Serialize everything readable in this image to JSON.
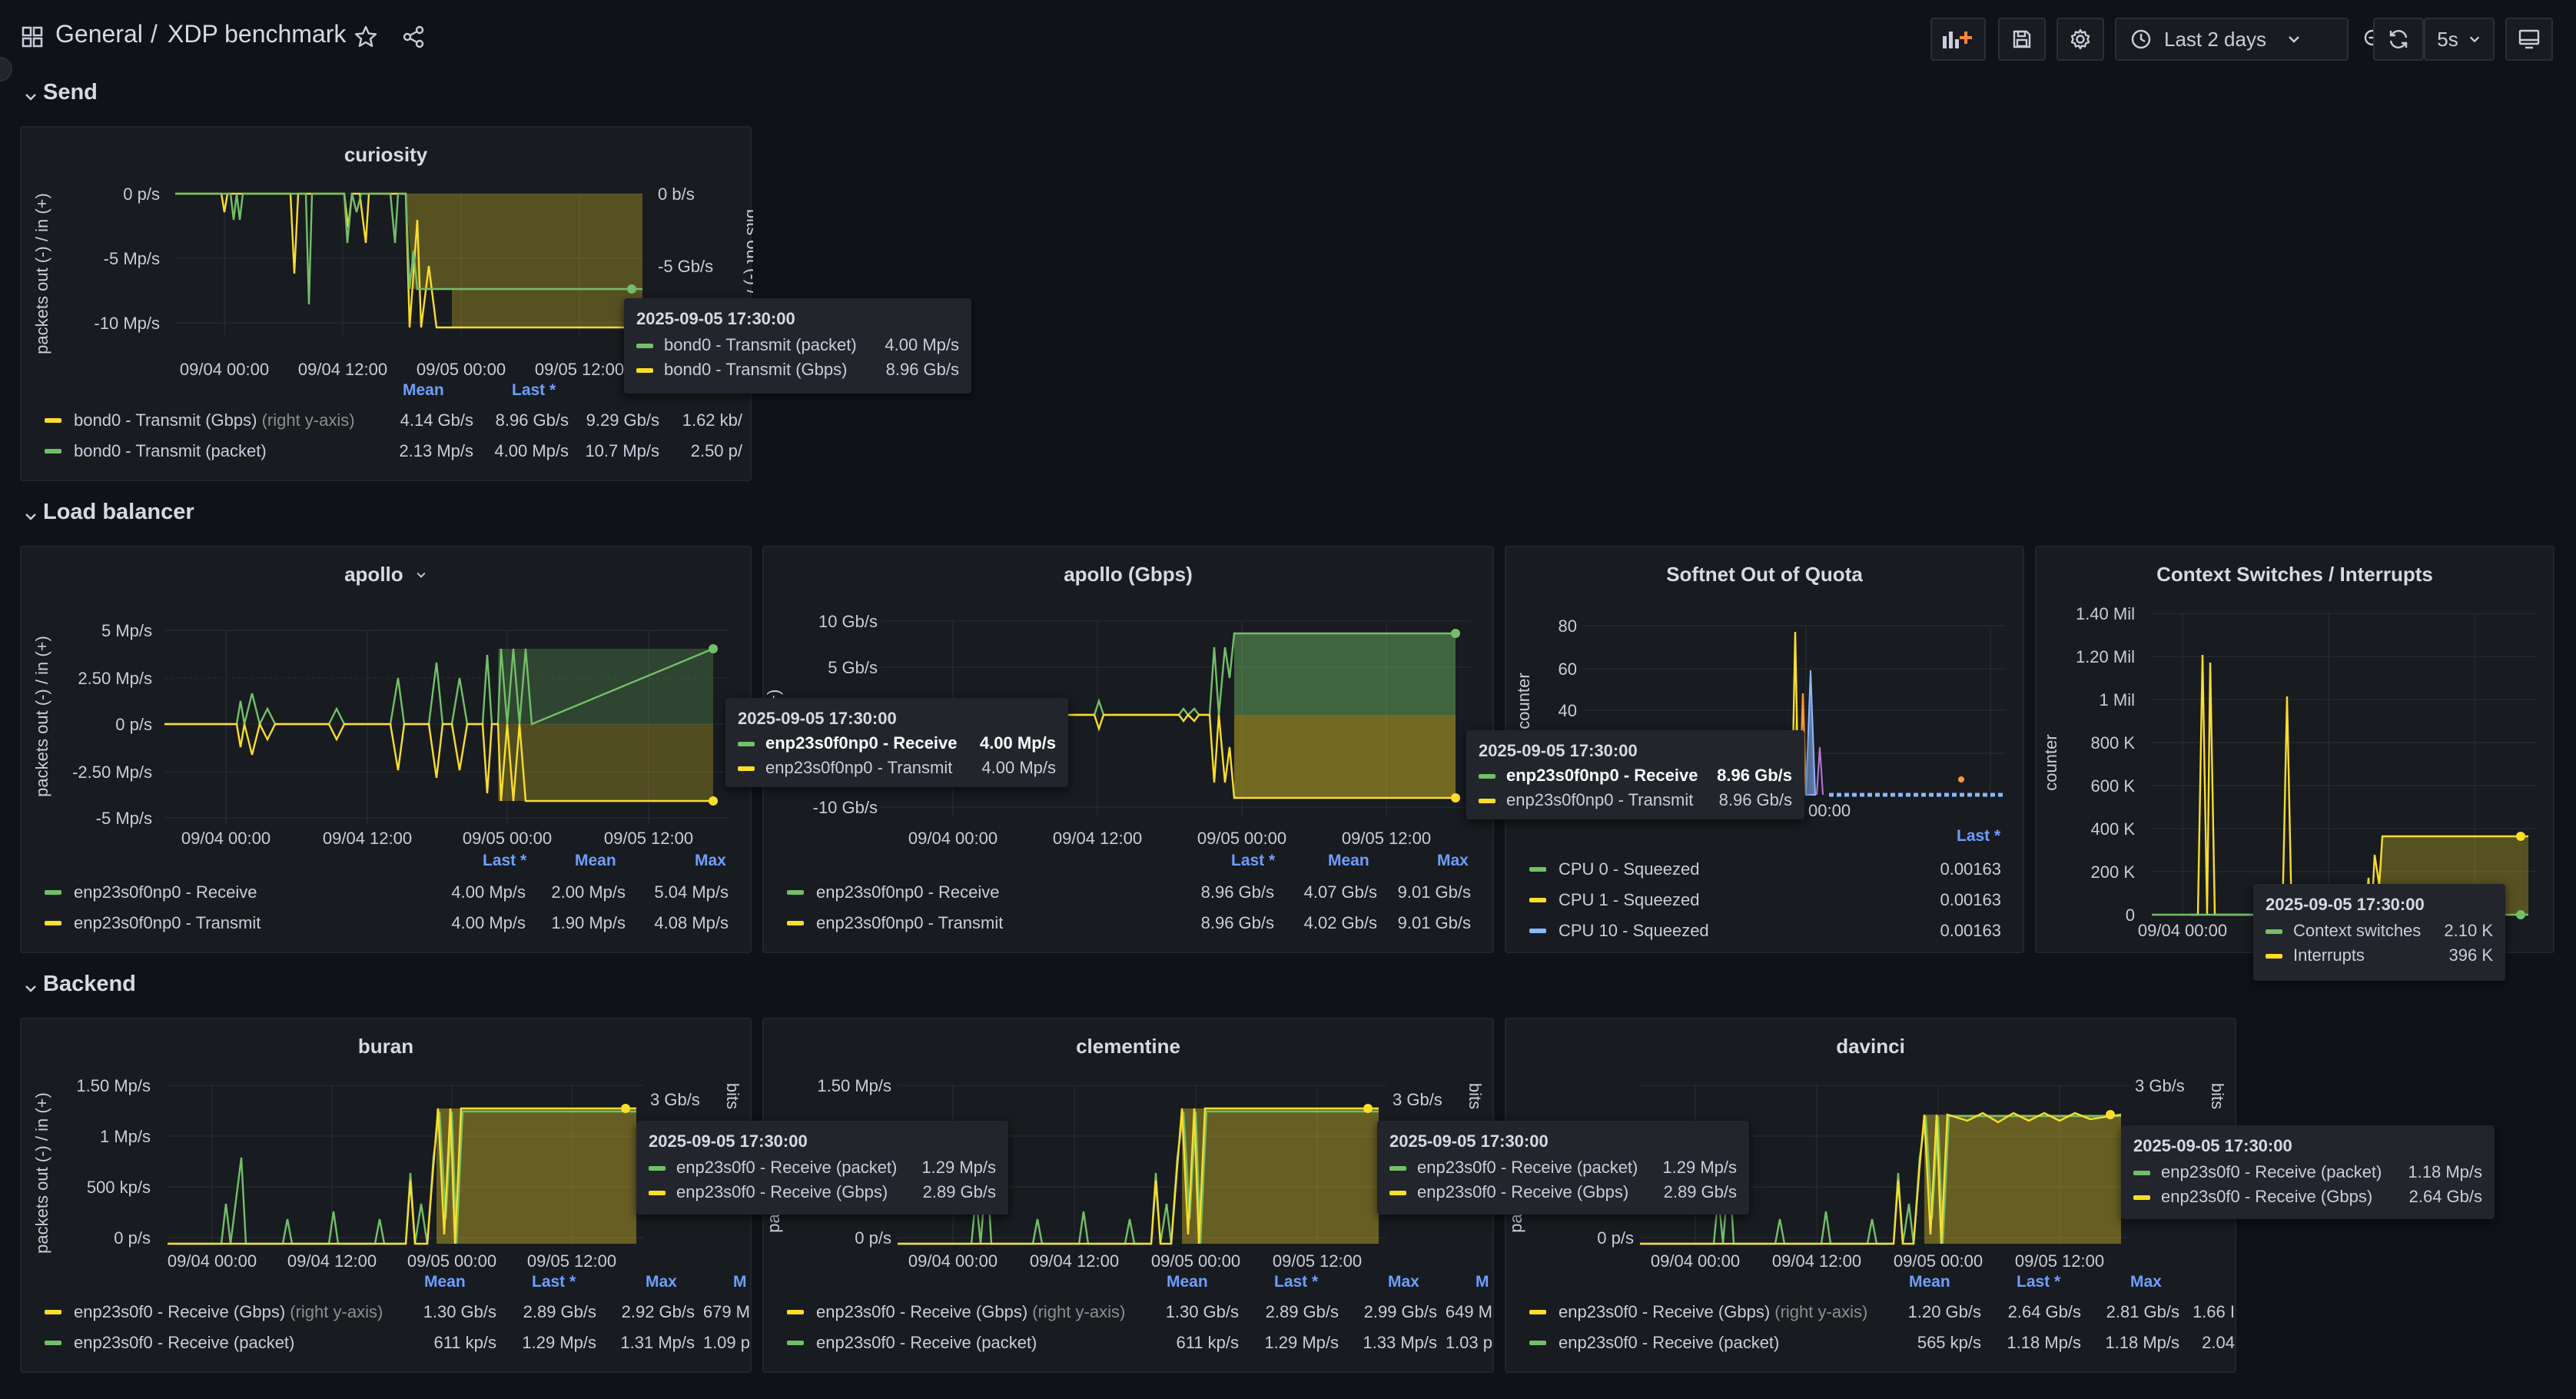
{
  "nav": {
    "breadcrumb_root": "General",
    "breadcrumb_sep": "/",
    "dashboard_title": "XDP benchmark",
    "time_range": "Last 2 days",
    "refresh_interval": "5s"
  },
  "colors": {
    "green": "#73bf69",
    "yellow": "#fade2a",
    "blue": "#8ab8ff",
    "legend_header": "#6e9fff",
    "background": "#111217",
    "panel": "#181b1f"
  },
  "rows": {
    "send": "Send",
    "load_balancer": "Load balancer",
    "backend": "Backend"
  },
  "curiosity": {
    "title": "curiosity",
    "y_left_label": "packets out (-) / in (+)",
    "y_right_label": "bits out (-) / in (+)",
    "y_left_ticks": [
      "0 p/s",
      "-5 Mp/s",
      "-10 Mp/s"
    ],
    "y_right_ticks": [
      "0 b/s",
      "-5 Gb/s"
    ],
    "x_ticks": [
      "09/04 00:00",
      "09/04 12:00",
      "09/05 00:00",
      "09/05 12:00"
    ],
    "legend_headers": [
      "Mean",
      "Last *"
    ],
    "legend": [
      {
        "name": "bond0 - Transmit (Gbps)",
        "suffix": "(right y-axis)",
        "color": "yellow",
        "values": [
          "4.14 Gb/s",
          "8.96 Gb/s",
          "9.29 Gb/s",
          "1.62 kb/"
        ]
      },
      {
        "name": "bond0 - Transmit (packet)",
        "suffix": "",
        "color": "green",
        "values": [
          "2.13 Mp/s",
          "4.00 Mp/s",
          "10.7 Mp/s",
          "2.50 p/"
        ]
      }
    ],
    "tooltip": {
      "time": "2025-09-05 17:30:00",
      "rows": [
        {
          "name": "bond0 - Transmit (packet)",
          "value": "4.00 Mp/s",
          "color": "green"
        },
        {
          "name": "bond0 - Transmit (Gbps)",
          "value": "8.96 Gb/s",
          "color": "yellow"
        }
      ]
    }
  },
  "apollo": {
    "title": "apollo",
    "y_label": "packets out (-) / in (+)",
    "y_ticks": [
      "5 Mp/s",
      "2.50 Mp/s",
      "0 p/s",
      "-2.50 Mp/s",
      "-5 Mp/s"
    ],
    "x_ticks": [
      "09/04 00:00",
      "09/04 12:00",
      "09/05 00:00",
      "09/05 12:00"
    ],
    "legend_headers": [
      "Last *",
      "Mean",
      "Max"
    ],
    "legend": [
      {
        "name": "enp23s0f0np0 - Receive",
        "color": "green",
        "values": [
          "4.00 Mp/s",
          "2.00 Mp/s",
          "5.04 Mp/s"
        ]
      },
      {
        "name": "enp23s0f0np0 - Transmit",
        "color": "yellow",
        "values": [
          "4.00 Mp/s",
          "1.90 Mp/s",
          "4.08 Mp/s"
        ]
      }
    ],
    "tooltip": {
      "time": "2025-09-05 17:30:00",
      "rows": [
        {
          "name": "enp23s0f0np0 - Receive",
          "value": "4.00 Mp/s",
          "color": "green"
        },
        {
          "name": "enp23s0f0np0 - Transmit",
          "value": "4.00 Mp/s",
          "color": "yellow"
        }
      ]
    }
  },
  "apollo_gbps": {
    "title": "apollo (Gbps)",
    "y_label": "in (+)",
    "y_ticks": [
      "10 Gb/s",
      "5 Gb/s",
      "-10 Gb/s"
    ],
    "x_ticks": [
      "09/04 00:00",
      "09/04 12:00",
      "09/05 00:00",
      "09/05 12:00"
    ],
    "legend_headers": [
      "Last *",
      "Mean",
      "Max"
    ],
    "legend": [
      {
        "name": "enp23s0f0np0 - Receive",
        "color": "green",
        "values": [
          "8.96 Gb/s",
          "4.07 Gb/s",
          "9.01 Gb/s"
        ]
      },
      {
        "name": "enp23s0f0np0 - Transmit",
        "color": "yellow",
        "values": [
          "8.96 Gb/s",
          "4.02 Gb/s",
          "9.01 Gb/s"
        ]
      }
    ],
    "tooltip": {
      "time": "2025-09-05 17:30:00",
      "rows": [
        {
          "name": "enp23s0f0np0 - Receive",
          "value": "8.96 Gb/s",
          "color": "green"
        },
        {
          "name": "enp23s0f0np0 - Transmit",
          "value": "8.96 Gb/s",
          "color": "yellow"
        }
      ]
    }
  },
  "softnet": {
    "title": "Softnet Out of Quota",
    "y_label": "counter",
    "y_ticks": [
      "80",
      "60",
      "40"
    ],
    "x_ticks": [
      "09/05 00:00"
    ],
    "legend_headers": [
      "Last *"
    ],
    "legend": [
      {
        "name": "CPU 0 - Squeezed",
        "color": "green",
        "values": [
          "0.00163"
        ]
      },
      {
        "name": "CPU 1 - Squeezed",
        "color": "yellow",
        "values": [
          "0.00163"
        ]
      },
      {
        "name": "CPU 10 - Squeezed",
        "color": "blue",
        "values": [
          "0.00163"
        ]
      }
    ]
  },
  "ctx": {
    "title": "Context Switches / Interrupts",
    "y_label": "counter",
    "y_ticks": [
      "1.40 Mil",
      "1.20 Mil",
      "1 Mil",
      "800 K",
      "600 K",
      "400 K",
      "200 K",
      "0"
    ],
    "x_ticks": [
      "09/04 00:00"
    ],
    "tooltip": {
      "time": "2025-09-05 17:30:00",
      "rows": [
        {
          "name": "Context switches",
          "value": "2.10 K",
          "color": "green"
        },
        {
          "name": "Interrupts",
          "value": "396 K",
          "color": "yellow"
        }
      ]
    }
  },
  "buran": {
    "title": "buran",
    "y_left_label": "packets out (-) / in (+)",
    "y_right_label": "bits",
    "y_left_ticks": [
      "1.50 Mp/s",
      "1 Mp/s",
      "500 kp/s",
      "0 p/s"
    ],
    "y_right_ticks": [
      "3 Gb/s"
    ],
    "x_ticks": [
      "09/04 00:00",
      "09/04 12:00",
      "09/05 00:00",
      "09/05 12:00"
    ],
    "legend_headers": [
      "Mean",
      "Last *",
      "Max",
      "M"
    ],
    "legend": [
      {
        "name": "enp23s0f0 - Receive (Gbps)",
        "suffix": "(right y-axis)",
        "color": "yellow",
        "values": [
          "1.30 Gb/s",
          "2.89 Gb/s",
          "2.92 Gb/s",
          "679 M"
        ]
      },
      {
        "name": "enp23s0f0 - Receive (packet)",
        "suffix": "",
        "color": "green",
        "values": [
          "611 kp/s",
          "1.29 Mp/s",
          "1.31 Mp/s",
          "1.09 p"
        ]
      }
    ],
    "tooltip": {
      "time": "2025-09-05 17:30:00",
      "rows": [
        {
          "name": "enp23s0f0 - Receive (packet)",
          "value": "1.29 Mp/s",
          "color": "green"
        },
        {
          "name": "enp23s0f0 - Receive (Gbps)",
          "value": "2.89 Gb/s",
          "color": "yellow"
        }
      ]
    }
  },
  "clementine": {
    "title": "clementine",
    "y_left_label": "pac",
    "y_right_label": "bits",
    "y_left_ticks": [
      "1.50 Mp/s",
      "0 p/s"
    ],
    "y_right_ticks": [
      "3 Gb/s"
    ],
    "x_ticks": [
      "09/04 00:00",
      "09/04 12:00",
      "09/05 00:00",
      "09/05 12:00"
    ],
    "legend_headers": [
      "Mean",
      "Last *",
      "Max",
      "M"
    ],
    "legend": [
      {
        "name": "enp23s0f0 - Receive (Gbps)",
        "suffix": "(right y-axis)",
        "color": "yellow",
        "values": [
          "1.30 Gb/s",
          "2.89 Gb/s",
          "2.99 Gb/s",
          "649 M"
        ]
      },
      {
        "name": "enp23s0f0 - Receive (packet)",
        "suffix": "",
        "color": "green",
        "values": [
          "611 kp/s",
          "1.29 Mp/s",
          "1.33 Mp/s",
          "1.03 p"
        ]
      }
    ],
    "tooltip": {
      "time": "2025-09-05 17:30:00",
      "rows": [
        {
          "name": "enp23s0f0 - Receive (packet)",
          "value": "1.29 Mp/s",
          "color": "green"
        },
        {
          "name": "enp23s0f0 - Receive (Gbps)",
          "value": "2.89 Gb/s",
          "color": "yellow"
        }
      ]
    }
  },
  "davinci": {
    "title": "davinci",
    "y_left_label": "pac",
    "y_right_label": "bits",
    "y_left_ticks": [
      "0 p/s"
    ],
    "y_right_ticks": [
      "3 Gb/s"
    ],
    "x_ticks": [
      "09/04 00:00",
      "09/04 12:00",
      "09/05 00:00",
      "09/05 12:00"
    ],
    "legend_headers": [
      "Mean",
      "Last *",
      "Max"
    ],
    "legend": [
      {
        "name": "enp23s0f0 - Receive (Gbps)",
        "suffix": "(right y-axis)",
        "color": "yellow",
        "values": [
          "1.20 Gb/s",
          "2.64 Gb/s",
          "2.81 Gb/s",
          "1.66 I"
        ]
      },
      {
        "name": "enp23s0f0 - Receive (packet)",
        "suffix": "",
        "color": "green",
        "values": [
          "565 kp/s",
          "1.18 Mp/s",
          "1.18 Mp/s",
          "2.04"
        ]
      }
    ],
    "tooltip": {
      "time": "2025-09-05 17:30:00",
      "rows": [
        {
          "name": "enp23s0f0 - Receive (packet)",
          "value": "1.18 Mp/s",
          "color": "green"
        },
        {
          "name": "enp23s0f0 - Receive (Gbps)",
          "value": "2.64 Gb/s",
          "color": "yellow"
        }
      ]
    }
  }
}
